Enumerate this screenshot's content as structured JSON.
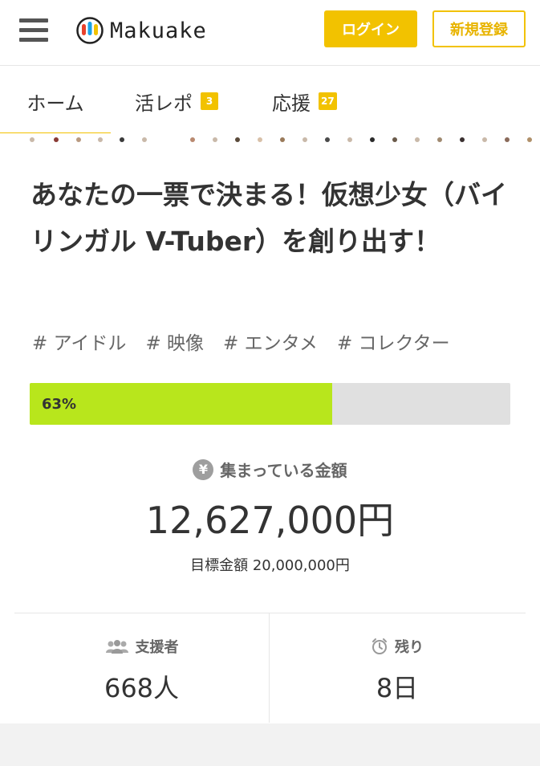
{
  "header": {
    "logo_text": "Makuake",
    "login_label": "ログイン",
    "register_label": "新規登録"
  },
  "tabs": [
    {
      "label": "ホーム",
      "badge": null,
      "active": true
    },
    {
      "label": "活レポ",
      "badge": "3",
      "active": false
    },
    {
      "label": "応援",
      "badge": "27",
      "active": false
    }
  ],
  "project": {
    "title": "あなたの一票で決まる！仮想少女（バイリンガル V-Tuber）を創り出す！",
    "tags": [
      "# アイドル",
      "# 映像",
      "# エンタメ",
      "# コレクター"
    ],
    "progress_percent": 63,
    "progress_label": "63%",
    "funded_heading": "集まっている金額",
    "funded_amount": "12,627,000円",
    "goal_text": "目標金額 20,000,000円",
    "supporters_heading": "支援者",
    "supporters_value": "668人",
    "remaining_heading": "残り",
    "remaining_value": "8日"
  },
  "colors": {
    "accent": "#f2c200",
    "progress_fill": "#b8e61c",
    "progress_track": "#e0e0e0"
  },
  "icons": {
    "menu": "hamburger-icon",
    "funded": "yen-icon",
    "supporters": "people-icon",
    "remaining": "clock-icon"
  }
}
